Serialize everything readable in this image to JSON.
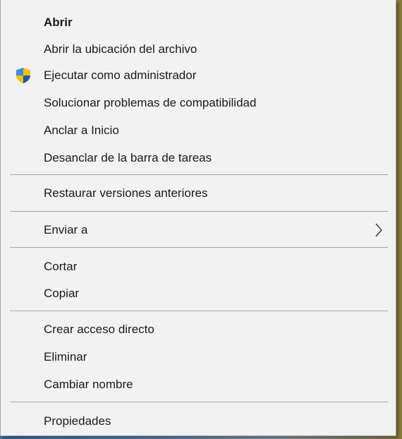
{
  "context_menu": {
    "items": [
      {
        "label": "Abrir"
      },
      {
        "label": "Abrir la ubicación del archivo"
      },
      {
        "label": "Ejecutar como administrador",
        "icon": "uac-shield-icon"
      },
      {
        "label": "Solucionar problemas de compatibilidad"
      },
      {
        "label": "Anclar a Inicio"
      },
      {
        "label": "Desanclar de la barra de tareas"
      },
      {
        "label": "Restaurar versiones anteriores"
      },
      {
        "label": "Enviar a",
        "icon": "chevron-right-icon"
      },
      {
        "label": "Cortar"
      },
      {
        "label": "Copiar"
      },
      {
        "label": "Crear acceso directo"
      },
      {
        "label": "Eliminar"
      },
      {
        "label": "Cambiar nombre"
      },
      {
        "label": "Propiedades"
      }
    ]
  },
  "colors": {
    "menu_background": "#f2f2f2",
    "separator": "#a8a8a8",
    "text": "#1a1a1a",
    "shield_blue": "#2f6fc9",
    "shield_yellow": "#f2c200"
  }
}
